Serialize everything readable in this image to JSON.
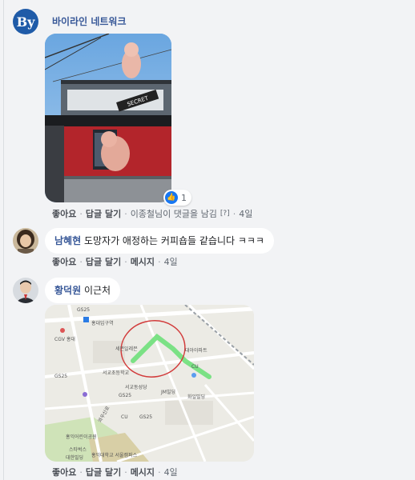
{
  "post": {
    "author": "바이라인 네트워크",
    "avatar_text": "By"
  },
  "reaction": {
    "count": "1"
  },
  "action_row_1": {
    "like": "좋아요",
    "reply": "답글 달기",
    "activity": "이종철님이 댓글을 남김",
    "flag": "[?]",
    "time": "4일"
  },
  "comment_1": {
    "name": "남혜현",
    "text": "도망자가 애정하는 커피숍들 같습니다 ㅋㅋㅋ",
    "actions": {
      "like": "좋아요",
      "reply": "답글 달기",
      "message": "메시지",
      "time": "4일"
    }
  },
  "comment_2": {
    "name": "황덕원",
    "text": "이근처",
    "actions": {
      "like": "좋아요",
      "reply": "답글 달기",
      "message": "메시지",
      "time": "4일"
    }
  },
  "sign": {
    "text": "SECRET"
  },
  "map_labels": {
    "cgv": "CGV 홍대",
    "hongik_station": "홍대입구역",
    "gs25_a": "GS25",
    "gs25_b": "GS25",
    "gs25_c": "GS25",
    "gs25_d": "GS25",
    "cu": "CU",
    "cu2": "CU",
    "school": "서교초등학교",
    "seogyo": "서교동성당",
    "seil": "세븐일레븐",
    "building": "대아아파트",
    "jm": "JM빌딩",
    "hwa": "화일빌딩",
    "hongik": "홍익대학교 서울캠퍼스",
    "park": "홍익어린이공원",
    "wuwoo": "와우산로",
    "starbucks": "스타벅스",
    "daehan": "대한빌딩"
  }
}
